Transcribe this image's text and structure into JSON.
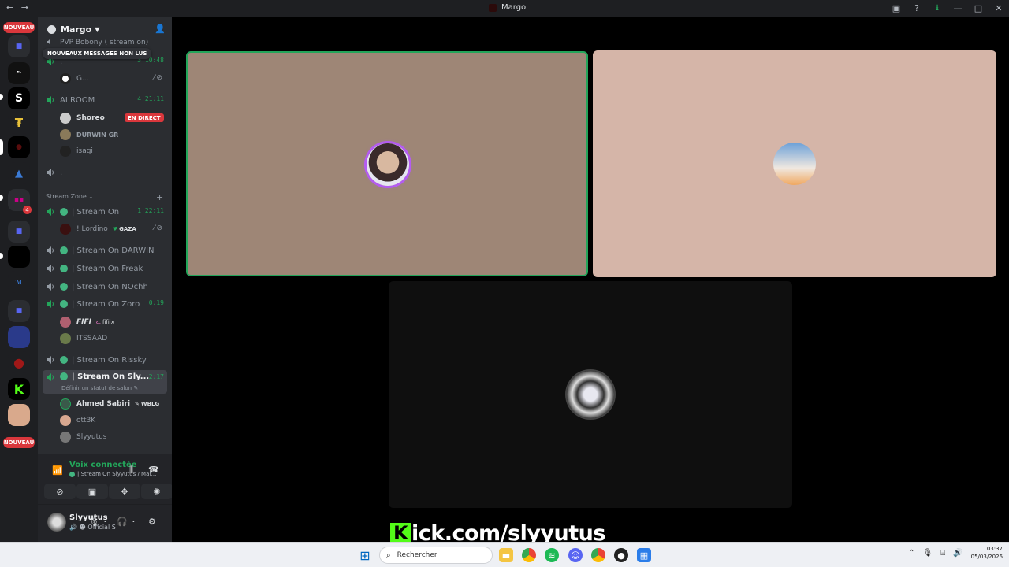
{
  "window": {
    "title": "Margo",
    "nav_back": "←",
    "nav_forward": "→",
    "buttons": {
      "minimize": "—",
      "maximize": "□",
      "close": "✕"
    }
  },
  "rail": {
    "new_top": "NOUVEAU",
    "new_bottom": "NOUVEAU",
    "mention_count": "4"
  },
  "guild": {
    "name": "Margo",
    "unread_banner": "NOUVEAUX MESSAGES NON LUS"
  },
  "channels": {
    "top_channel": "PVP Bobony ( stream on)",
    "dot_channel_1": {
      "name": ".",
      "time": "3:10:48",
      "user": "G..."
    },
    "ai_room": {
      "name": "AI ROOM",
      "time": "4:21:11",
      "users": [
        {
          "name": "Shoreo",
          "badge": "EN DIRECT"
        },
        {
          "name": "DURWIN GR"
        },
        {
          "name": "isagi"
        }
      ]
    },
    "dot_channel_2": {
      "name": "."
    },
    "category": "Stream Zone",
    "stream_on": {
      "name": "| Stream On",
      "time": "1:22:11",
      "user": "! Lordino",
      "user_tag": "GAZA"
    },
    "stream_darwin": "| Stream On DARWIN",
    "stream_freak": "| Stream On Freak",
    "stream_nochh": "| Stream On NOchh",
    "stream_zoro": {
      "name": "| Stream On Zoro",
      "time": "0:19",
      "users": [
        {
          "name": "FIFI",
          "tag": "fifiix"
        },
        {
          "name": "ITSSAAD"
        }
      ]
    },
    "stream_rissky": "| Stream On Rissky",
    "stream_sly": {
      "name": "| Stream On Sly...",
      "time": "2:17",
      "status": "Définir un statut de salon",
      "users": [
        {
          "name": "Ahmed Sabiri",
          "tag": "WBLG"
        },
        {
          "name": "ott3K"
        },
        {
          "name": "Slyyutus"
        }
      ]
    }
  },
  "voice": {
    "status": "Voix connectée",
    "channel": "| Stream On Slyyutus / Mar..."
  },
  "user": {
    "name": "Slyyutus",
    "status": "Official S"
  },
  "stream_overlay": {
    "k": "K",
    "text": "ick.com/slyyutus"
  },
  "taskbar": {
    "search_placeholder": "Rechercher",
    "time": "03:37",
    "date": "05/03/2026"
  },
  "colors": {
    "tile1": "#9e8676",
    "tile1_border": "#23a55a",
    "tile2": "#d5b5a8",
    "tile3": "#0f0f0f",
    "speaking_green": "#23a55a",
    "live_red": "#da373c",
    "kick_green": "#53fc18"
  }
}
